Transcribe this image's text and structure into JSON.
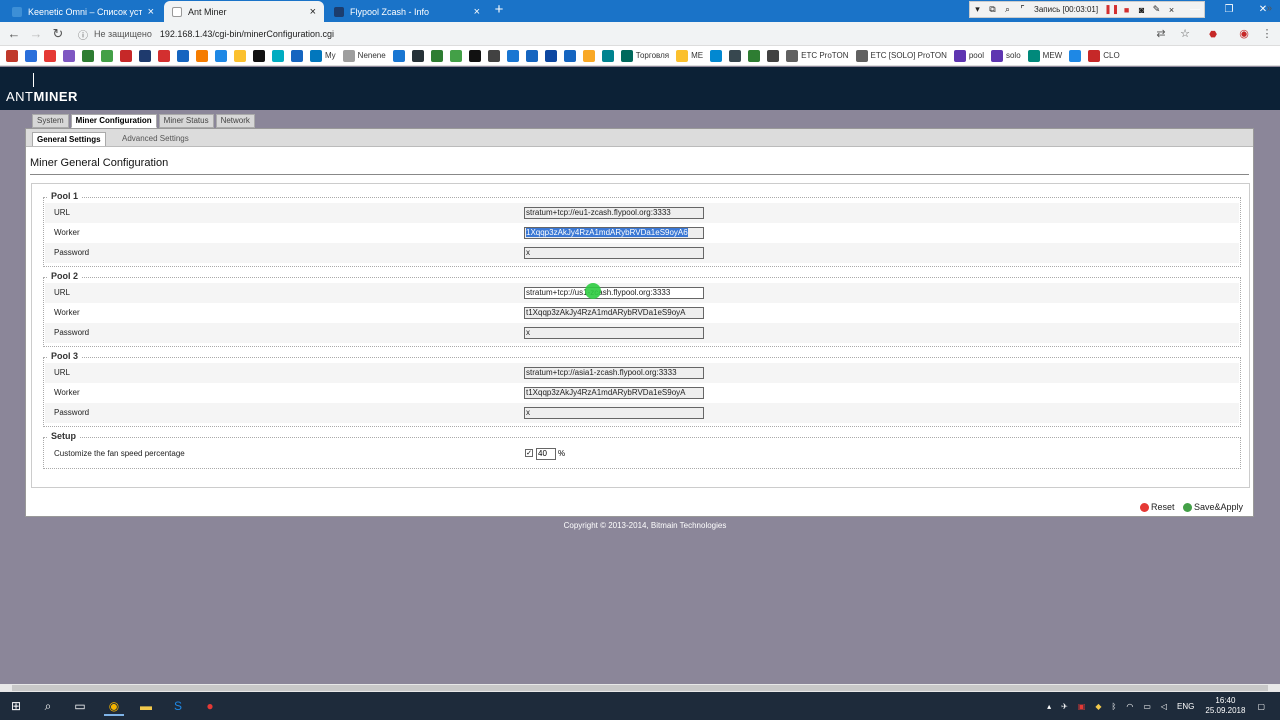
{
  "browser": {
    "tabs": [
      {
        "title": "Keenetic Omni – Список устройств",
        "active": false
      },
      {
        "title": "Ant Miner",
        "active": true
      },
      {
        "title": "Flypool Zcash - Info",
        "active": false
      }
    ],
    "new_tab_icon": "plus-icon",
    "recording": {
      "label": "Запись [00:03:01]"
    },
    "address": {
      "security": "Не защищено",
      "url": "192.168.1.43/cgi-bin/minerConfiguration.cgi"
    },
    "bookmarks": [
      {
        "label": "",
        "color": "#c0392b"
      },
      {
        "label": "",
        "color": "#2a6fdb"
      },
      {
        "label": "",
        "color": "#e53935"
      },
      {
        "label": "",
        "color": "#7e57c2"
      },
      {
        "label": "",
        "color": "#2e7d32"
      },
      {
        "label": "",
        "color": "#43a047"
      },
      {
        "label": "",
        "color": "#c62828"
      },
      {
        "label": "",
        "color": "#1e3a6d"
      },
      {
        "label": "",
        "color": "#d32f2f"
      },
      {
        "label": "",
        "color": "#1565c0"
      },
      {
        "label": "",
        "color": "#f57c00"
      },
      {
        "label": "",
        "color": "#1e88e5"
      },
      {
        "label": "",
        "color": "#fbc02d"
      },
      {
        "label": "",
        "color": "#111111"
      },
      {
        "label": "",
        "color": "#00acc1"
      },
      {
        "label": "",
        "color": "#1565c0"
      },
      {
        "label": "My",
        "color": "#0277bd"
      },
      {
        "label": "Nenene",
        "color": "#9e9e9e"
      },
      {
        "label": "",
        "color": "#1976d2"
      },
      {
        "label": "",
        "color": "#263238"
      },
      {
        "label": "",
        "color": "#2e7d32"
      },
      {
        "label": "",
        "color": "#43a047"
      },
      {
        "label": "",
        "color": "#111111"
      },
      {
        "label": "",
        "color": "#424242"
      },
      {
        "label": "",
        "color": "#1976d2"
      },
      {
        "label": "",
        "color": "#1565c0"
      },
      {
        "label": "",
        "color": "#0d47a1"
      },
      {
        "label": "",
        "color": "#1565c0"
      },
      {
        "label": "",
        "color": "#f9a825"
      },
      {
        "label": "",
        "color": "#00838f"
      },
      {
        "label": "Торговля",
        "color": "#00695c"
      },
      {
        "label": "ME",
        "color": "#fbc02d"
      },
      {
        "label": "",
        "color": "#0288d1"
      },
      {
        "label": "",
        "color": "#37474f"
      },
      {
        "label": "",
        "color": "#2e7d32"
      },
      {
        "label": "",
        "color": "#424242"
      },
      {
        "label": "ETC ProTON",
        "color": "#616161"
      },
      {
        "label": "ETC [SOLO] ProTON",
        "color": "#616161"
      },
      {
        "label": "pool",
        "color": "#5e35b1"
      },
      {
        "label": "solo",
        "color": "#5e35b1"
      },
      {
        "label": "MEW",
        "color": "#00897b"
      },
      {
        "label": "",
        "color": "#1e88e5"
      },
      {
        "label": "CLO",
        "color": "#c62828"
      }
    ]
  },
  "app": {
    "logo": {
      "ant": "ANT",
      "miner": "MINER"
    },
    "main_tabs": [
      {
        "label": "System",
        "active": false
      },
      {
        "label": "Miner Configuration",
        "active": true
      },
      {
        "label": "Miner Status",
        "active": false
      },
      {
        "label": "Network",
        "active": false
      }
    ],
    "sub_tabs": [
      {
        "label": "General Settings",
        "active": true
      },
      {
        "label": "Advanced Settings",
        "active": false
      }
    ],
    "page_title": "Miner General Configuration",
    "pools": [
      {
        "title": "Pool 1",
        "url_label": "URL",
        "url": "stratum+tcp://eu1-zcash.flypool.org:3333",
        "worker_label": "Worker",
        "worker": "1Xqqp3zAkJy4RzA1mdARybRVDa1eS9oyA6",
        "worker_selected": true,
        "password_label": "Password",
        "password": "x"
      },
      {
        "title": "Pool 2",
        "url_label": "URL",
        "url": "stratum+tcp://us1-zcash.flypool.org:3333",
        "worker_label": "Worker",
        "worker": "t1Xqqp3zAkJy4RzA1mdARybRVDa1eS9oyA",
        "worker_selected": false,
        "password_label": "Password",
        "password": "x"
      },
      {
        "title": "Pool 3",
        "url_label": "URL",
        "url": "stratum+tcp://asia1-zcash.flypool.org:3333",
        "worker_label": "Worker",
        "worker": "t1Xqqp3zAkJy4RzA1mdARybRVDa1eS9oyA",
        "worker_selected": false,
        "password_label": "Password",
        "password": "x"
      }
    ],
    "setup": {
      "title": "Setup",
      "fan_label": "Customize the fan speed percentage",
      "fan_checked": true,
      "fan_value": "40",
      "fan_unit": "%"
    },
    "buttons": {
      "reset": "Reset",
      "save": "Save&Apply"
    },
    "copyright": "Copyright © 2013-2014, Bitmain Technologies"
  },
  "taskbar": {
    "language": "ENG",
    "time": "16:40",
    "date": "25.09.2018"
  }
}
